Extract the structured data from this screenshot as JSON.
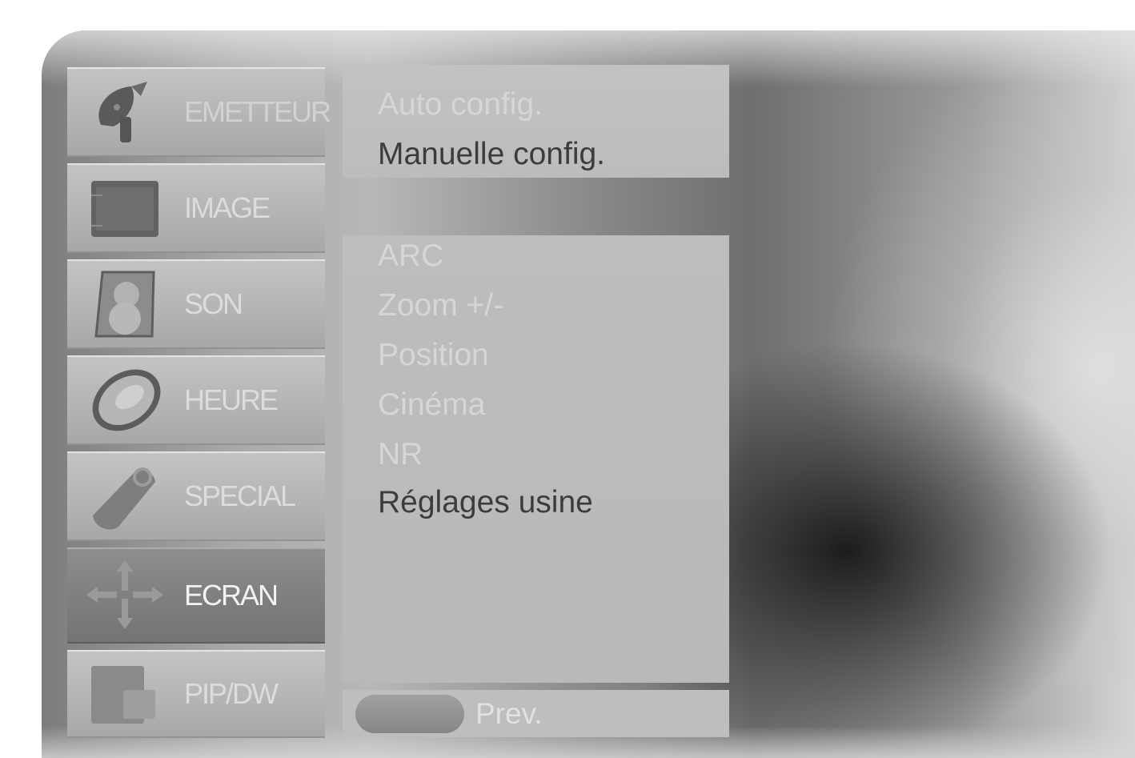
{
  "sidebar": {
    "items": [
      {
        "label": "EMETTEUR",
        "icon": "satellite-dish-icon",
        "state": "normal"
      },
      {
        "label": "IMAGE",
        "icon": "picture-icon",
        "state": "normal"
      },
      {
        "label": "SON",
        "icon": "speaker-icon",
        "state": "normal"
      },
      {
        "label": "HEURE",
        "icon": "clock-icon",
        "state": "normal"
      },
      {
        "label": "SPECIAL",
        "icon": "tag-icon",
        "state": "normal"
      },
      {
        "label": "ECRAN",
        "icon": "move-arrows-icon",
        "state": "active"
      },
      {
        "label": "PIP/DW",
        "icon": "pip-screen-icon",
        "state": "normal"
      }
    ]
  },
  "top_options": [
    {
      "label": "Auto config.",
      "enabled": false
    },
    {
      "label": "Manuelle config.",
      "enabled": true
    }
  ],
  "main_options": [
    {
      "label": "ARC",
      "enabled": false
    },
    {
      "label": "Zoom +/-",
      "enabled": false
    },
    {
      "label": "Position",
      "enabled": false
    },
    {
      "label": "Cinéma",
      "enabled": false
    },
    {
      "label": "NR",
      "enabled": false
    },
    {
      "label": "Réglages usine",
      "enabled": true
    }
  ],
  "footer": {
    "prev_label": "Prev."
  }
}
